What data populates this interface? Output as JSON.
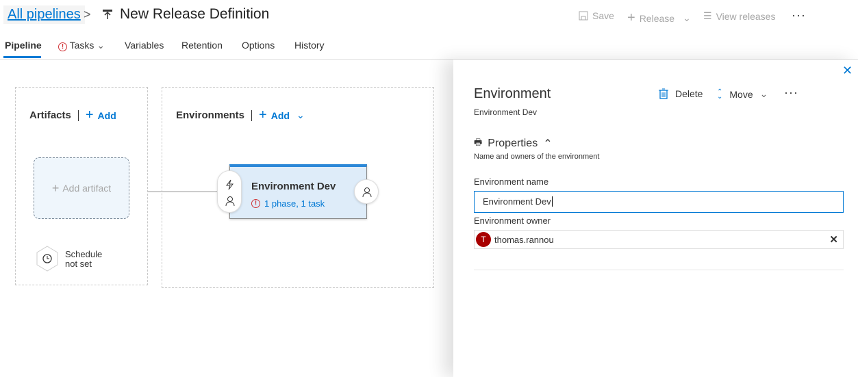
{
  "header": {
    "breadcrumb": "All pipelines",
    "title": "New Release Definition",
    "save": "Save",
    "release": "Release",
    "view_releases": "View releases"
  },
  "tabs": [
    {
      "label": "Pipeline",
      "active": true
    },
    {
      "label": "Tasks",
      "warning": true
    },
    {
      "label": "Variables"
    },
    {
      "label": "Retention"
    },
    {
      "label": "Options"
    },
    {
      "label": "History"
    }
  ],
  "canvas": {
    "artifacts_title": "Artifacts",
    "artifacts_add": "Add",
    "add_artifact": "Add artifact",
    "schedule_line1": "Schedule",
    "schedule_line2": "not set",
    "environments_title": "Environments",
    "environments_add": "Add",
    "env_card": {
      "name": "Environment Dev",
      "summary": "1 phase, 1 task"
    }
  },
  "panel": {
    "title": "Environment",
    "subtitle": "Environment Dev",
    "delete": "Delete",
    "move": "Move",
    "section": "Properties",
    "section_desc": "Name and owners of the environment",
    "name_label": "Environment name",
    "name_value": "Environment Dev",
    "owner_label": "Environment owner",
    "owner_initial": "T",
    "owner_name": "thomas.rannou"
  },
  "colors": {
    "accent": "#0078d4",
    "warning": "#d13438",
    "avatar": "#a80000",
    "card_bg": "#deecf9"
  }
}
